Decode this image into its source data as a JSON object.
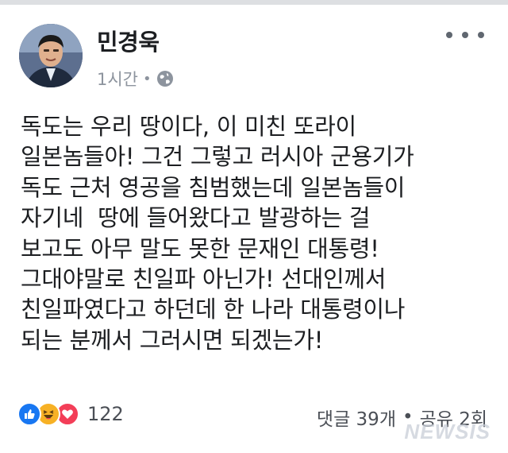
{
  "post": {
    "author": "민경욱",
    "time": "1시간",
    "separator": "•",
    "privacy_icon": "globe-icon",
    "more_icon": "more-options-icon",
    "lines": [
      "독도는 우리 땅이다, 이 미친 또라이",
      "일본놈들아! 그건 그렇고 러시아 군용기가",
      "독도 근처 영공을 침범했는데 일본놈들이",
      "자기네  땅에 들어왔다고 발광하는 걸",
      "보고도 아무 말도 못한 문재인 대통령!",
      "그대야말로 친일파 아닌가! 선대인께서",
      "친일파였다고 하던데 한 나라 대통령이나",
      "되는 분께서 그러시면 되겠는가!"
    ]
  },
  "footer": {
    "reaction_icons": [
      "like-icon",
      "haha-icon",
      "love-icon"
    ],
    "reaction_count": "122",
    "comments": "댓글 39개",
    "stats_separator": "•",
    "shares": "공유 2회"
  },
  "watermark": "NEWSIS",
  "colors": {
    "text": "#1c1e21",
    "meta": "#8d949e",
    "like": "#1877f2",
    "haha": "#f7b125",
    "love": "#f33e58"
  }
}
